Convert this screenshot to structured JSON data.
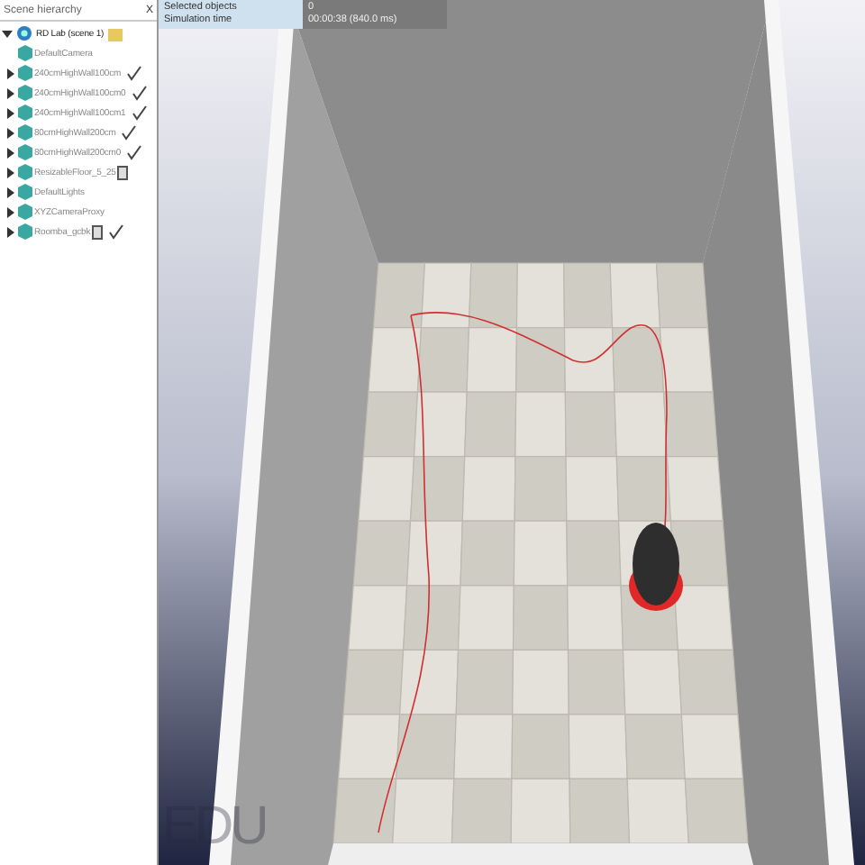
{
  "hierarchy": {
    "title": "Scene hierarchy",
    "close": "X",
    "root": {
      "label": "RD Lab (scene 1)",
      "expanded": true,
      "children": [
        {
          "label": "DefaultCamera",
          "expanded": false,
          "has_children": false,
          "script": false,
          "document": false
        },
        {
          "label": "240cmHighWall100cm",
          "expanded": false,
          "has_children": true,
          "script": true,
          "document": false
        },
        {
          "label": "240cmHighWall100cm0",
          "expanded": false,
          "has_children": true,
          "script": true,
          "document": false
        },
        {
          "label": "240cmHighWall100cm1",
          "expanded": false,
          "has_children": true,
          "script": true,
          "document": false
        },
        {
          "label": "80cmHighWall200cm",
          "expanded": false,
          "has_children": true,
          "script": true,
          "document": false
        },
        {
          "label": "80cmHighWall200cm0",
          "expanded": false,
          "has_children": true,
          "script": true,
          "document": false
        },
        {
          "label": "ResizableFloor_5_25",
          "expanded": false,
          "has_children": true,
          "script": false,
          "document": true
        },
        {
          "label": "DefaultLights",
          "expanded": false,
          "has_children": true,
          "script": false,
          "document": false
        },
        {
          "label": "XYZCameraProxy",
          "expanded": false,
          "has_children": true,
          "script": false,
          "document": false
        },
        {
          "label": "Roomba_gcbk",
          "expanded": false,
          "has_children": true,
          "script": true,
          "document": true
        }
      ]
    }
  },
  "info": {
    "lines": [
      {
        "label": "Selected objects",
        "value": "0"
      },
      {
        "label": "Simulation time",
        "value": "00:00:38 (840.0 ms)"
      }
    ]
  },
  "viewport": {
    "watermark": "EDU"
  }
}
